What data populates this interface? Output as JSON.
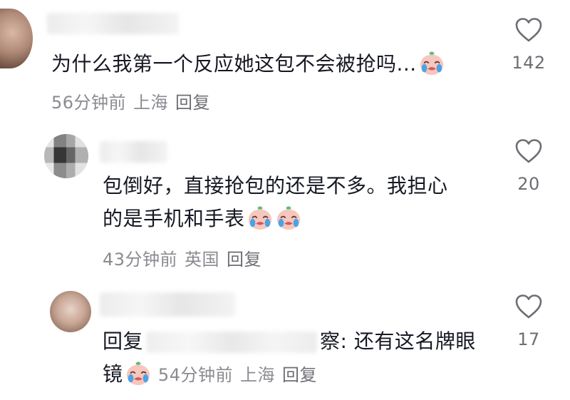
{
  "comments": [
    {
      "text": "为什么我第一个反应她这包不会被抢吗...",
      "time": "56分钟前",
      "location": "上海",
      "reply_label": "回复",
      "likes": "142",
      "emoji": "crying-face-emoji"
    },
    {
      "text_line1": "包倒好，直接抢包的还是不多。我担心",
      "text_line2": "的是手机和手表",
      "time": "43分钟前",
      "location": "英国",
      "reply_label": "回复",
      "likes": "20",
      "emoji": "crying-face-emoji"
    },
    {
      "reply_prefix": "回复",
      "mention_tail": "察",
      "text_line1": ": 还有这名牌眼",
      "text_line2": "镜",
      "time": "54分钟前",
      "location": "上海",
      "reply_label": "回复",
      "likes": "17",
      "emoji": "crying-face-emoji"
    }
  ],
  "icons": {
    "like": "heart-outline-icon",
    "emoji": "crying-face-emoji"
  },
  "colors": {
    "text": "#161823",
    "meta": "#8a8b91",
    "like_outline": "#6d6e74"
  }
}
